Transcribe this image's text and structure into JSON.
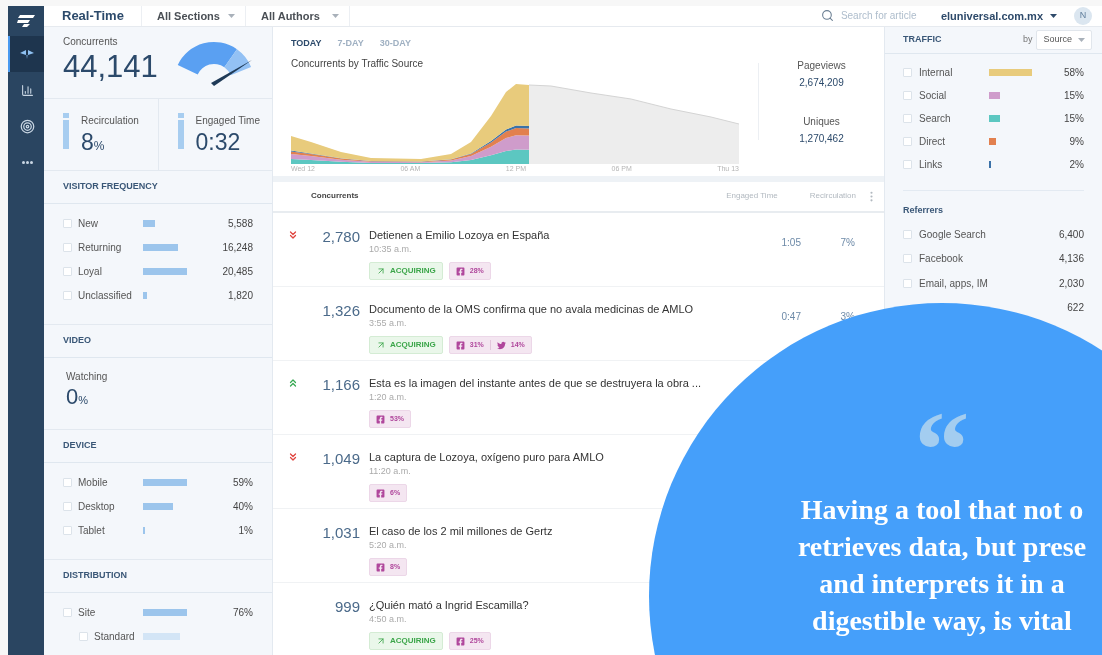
{
  "nav": {
    "items": [
      {
        "kind": "dashboard",
        "selected": true
      },
      {
        "kind": "chart",
        "selected": false
      },
      {
        "kind": "target",
        "selected": false
      },
      {
        "kind": "more",
        "selected": false
      }
    ]
  },
  "header": {
    "title": "Real-Time",
    "filters": [
      "All Sections",
      "All Authors"
    ],
    "search": {
      "placeholder": "Search for article"
    },
    "site": "eluniversal.com.mx",
    "avatar": "N"
  },
  "summary": {
    "label": "Concurrents",
    "value": "44,141",
    "metrics": [
      {
        "label": "Recirculation",
        "value": "8",
        "unit": "%"
      },
      {
        "label": "Engaged Time",
        "value": "0:32"
      }
    ]
  },
  "sections": [
    {
      "kind": "bars",
      "title": "VISITOR FREQUENCY",
      "rows": [
        {
          "label": "New",
          "value": "5,588",
          "checked": false
        },
        {
          "label": "Returning",
          "value": "16,248",
          "checked": false
        },
        {
          "label": "Loyal",
          "value": "20,485",
          "checked": false
        },
        {
          "label": "Unclassified",
          "value": "1,820",
          "checked": false
        }
      ]
    },
    {
      "kind": "stat",
      "title": "VIDEO",
      "label": "Watching",
      "value": "0",
      "unit": "%"
    },
    {
      "kind": "bars",
      "title": "DEVICE",
      "rows": [
        {
          "label": "Mobile",
          "value": "59%",
          "checked": false
        },
        {
          "label": "Desktop",
          "value": "40%",
          "checked": false
        },
        {
          "label": "Tablet",
          "value": "1%",
          "checked": false
        }
      ]
    },
    {
      "kind": "bars",
      "title": "DISTRIBUTION",
      "rows": [
        {
          "label": "Site",
          "value": "76%",
          "checked": false,
          "children": [
            {
              "label": "Standard",
              "checked": false
            }
          ]
        }
      ]
    }
  ],
  "overview": {
    "tabs": [
      {
        "label": "TODAY",
        "selected": true
      },
      {
        "label": "7-DAY",
        "selected": false
      },
      {
        "label": "30-DAY",
        "selected": false
      }
    ],
    "chart_title": "Concurrents by Traffic Source",
    "x_labels": [
      "Wed 12",
      "06 AM",
      "12 PM",
      "06 PM",
      "Thu 13"
    ],
    "stats": [
      {
        "label": "Pageviews",
        "value": "2,674,209"
      },
      {
        "label": "Uniques",
        "value": "1,270,462"
      }
    ]
  },
  "articles": {
    "columns": [
      "Concurrents",
      "Engaged Time",
      "Recirculation"
    ],
    "rows": [
      {
        "rising": false,
        "falling": true,
        "concurrents": "2,780",
        "title": "Detienen a Emilio Lozoya en España",
        "time": "10:35 a.m.",
        "engaged": "1:05",
        "recirculation": "7%",
        "badges": [
          {
            "kind": "acquiring",
            "label": "ACQUIRING"
          },
          {
            "kind": "social",
            "shares": [
              {
                "kind": "facebook",
                "value": "28%"
              }
            ]
          }
        ]
      },
      {
        "rising": false,
        "falling": false,
        "concurrents": "1,326",
        "title": "Documento de la OMS confirma que no avala medicinas de AMLO",
        "time": "3:55 a.m.",
        "engaged": "0:47",
        "recirculation": "3%",
        "badges": [
          {
            "kind": "acquiring",
            "label": "ACQUIRING"
          },
          {
            "kind": "social",
            "shares": [
              {
                "kind": "facebook",
                "value": "31%"
              },
              {
                "kind": "twitter",
                "value": "14%"
              }
            ]
          }
        ]
      },
      {
        "rising": true,
        "falling": false,
        "concurrents": "1,166",
        "title": "Esta es la imagen del instante antes de que se destruyera la obra ...",
        "time": "1:20 a.m.",
        "badges": [
          {
            "kind": "social",
            "shares": [
              {
                "kind": "facebook",
                "value": "53%"
              }
            ]
          }
        ]
      },
      {
        "rising": false,
        "falling": true,
        "concurrents": "1,049",
        "title": "La captura de Lozoya, oxígeno puro para AMLO",
        "time": "11:20 a.m.",
        "badges": [
          {
            "kind": "social",
            "shares": [
              {
                "kind": "facebook",
                "value": "6%"
              }
            ]
          }
        ]
      },
      {
        "rising": false,
        "falling": false,
        "concurrents": "1,031",
        "title": "El caso de los 2 mil millones de Gertz",
        "time": "5:20 a.m.",
        "badges": [
          {
            "kind": "social",
            "shares": [
              {
                "kind": "facebook",
                "value": "8%"
              }
            ]
          }
        ]
      },
      {
        "rising": false,
        "falling": false,
        "concurrents": "999",
        "title": "¿Quién mató a Ingrid Escamilla?",
        "time": "4:50 a.m.",
        "badges": [
          {
            "kind": "acquiring",
            "label": "ACQUIRING"
          },
          {
            "kind": "social",
            "shares": [
              {
                "kind": "facebook",
                "value": "25%"
              }
            ]
          }
        ]
      }
    ]
  },
  "traffic": {
    "title": "TRAFFIC",
    "by_label": "by",
    "by_value": "Source",
    "rows": [
      {
        "label": "Internal",
        "color": "#e8cb7c",
        "value": "58%",
        "checked": false
      },
      {
        "label": "Social",
        "color": "#cf9ccb",
        "value": "15%",
        "checked": false
      },
      {
        "label": "Search",
        "color": "#5cc7c1",
        "value": "15%",
        "checked": false
      },
      {
        "label": "Direct",
        "color": "#e2804f",
        "value": "9%",
        "checked": false
      },
      {
        "label": "Links",
        "color": "#3b72a8",
        "value": "2%",
        "checked": false
      }
    ]
  },
  "referrers": {
    "title": "Referrers",
    "rows": [
      {
        "label": "Google Search",
        "value": "6,400",
        "checked": false
      },
      {
        "label": "Facebook",
        "value": "4,136",
        "checked": false
      },
      {
        "label": "Email, apps, IM",
        "value": "2,030",
        "checked": false
      },
      {
        "value": "622"
      }
    ]
  },
  "quote": {
    "mark": "“",
    "lines": [
      "Having a tool that not o",
      "retrieves data, but prese",
      "and interprets it in a",
      "digestible way, is vital"
    ]
  }
}
